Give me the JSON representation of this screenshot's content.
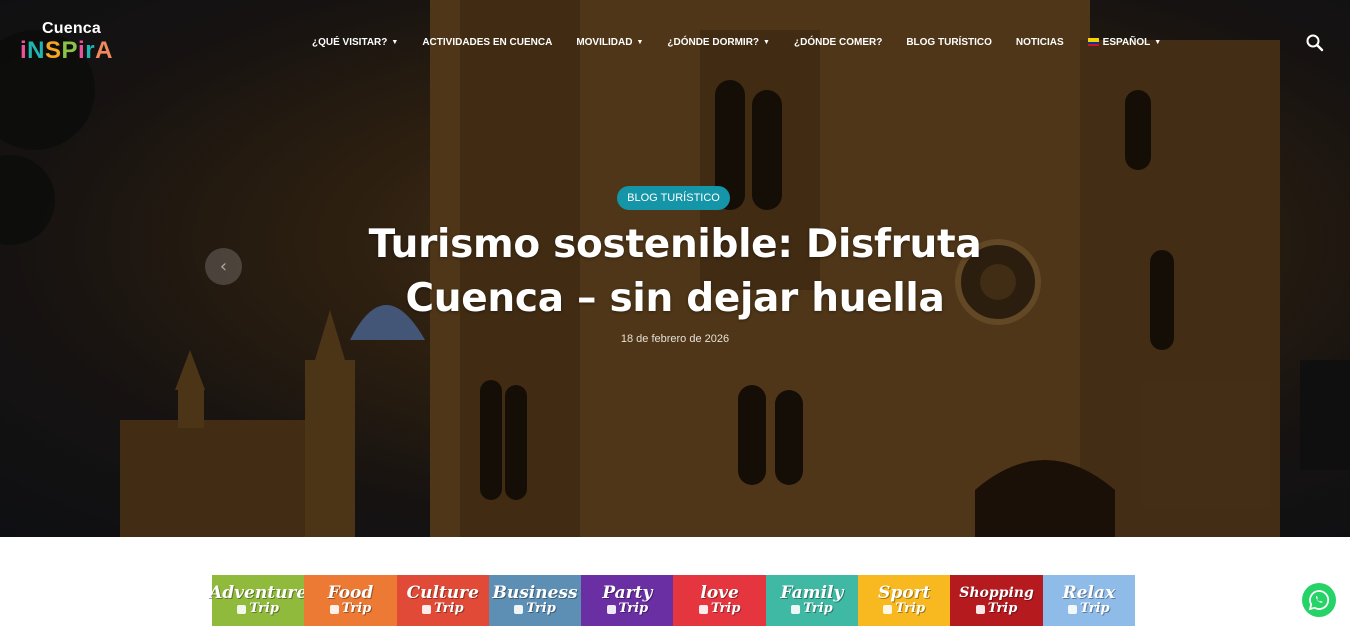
{
  "logo": {
    "line1": "Cuenca",
    "line2_letters": [
      "i",
      "N",
      "S",
      "P",
      "i",
      "r",
      "A"
    ],
    "line2_colors": [
      "#e9539b",
      "#20b5b0",
      "#f5a623",
      "#8bc34a",
      "#e9539b",
      "#20b5b0",
      "#f08a5d"
    ]
  },
  "nav": {
    "items": [
      {
        "label": "¿QUÉ VISITAR?",
        "dropdown": true
      },
      {
        "label": "ACTIVIDADES EN CUENCA",
        "dropdown": false
      },
      {
        "label": "MOVILIDAD",
        "dropdown": true
      },
      {
        "label": "¿DÓNDE DORMIR?",
        "dropdown": true
      },
      {
        "label": "¿DÓNDE COMER?",
        "dropdown": false
      },
      {
        "label": "BLOG TURÍSTICO",
        "dropdown": false
      },
      {
        "label": "NOTICIAS",
        "dropdown": false
      },
      {
        "label": "ESPAÑOL",
        "dropdown": true,
        "flag": "ecuador-flag-icon"
      }
    ],
    "search_icon": "search-icon"
  },
  "hero": {
    "category": "BLOG TURÍSTICO",
    "title": "Turismo sostenible: Disfruta Cuenca – sin dejar huella",
    "date": "18 de febrero de 2026",
    "prev_icon": "chevron-left-icon"
  },
  "trips": [
    {
      "word": "Adventure",
      "trip": "Trip",
      "color": "#8fba3c"
    },
    {
      "word": "Food",
      "trip": "Trip",
      "color": "#ec7a35"
    },
    {
      "word": "Culture",
      "trip": "Trip",
      "color": "#e04a36"
    },
    {
      "word": "Business",
      "trip": "Trip",
      "color": "#5d8fb5"
    },
    {
      "word": "Party",
      "trip": "Trip",
      "color": "#6a2fa3"
    },
    {
      "word": "love",
      "trip": "Trip",
      "color": "#e5363f"
    },
    {
      "word": "Family",
      "trip": "Trip",
      "color": "#3fb9a3"
    },
    {
      "word": "Sport",
      "trip": "Trip",
      "color": "#f8b820"
    },
    {
      "word": "Shopping",
      "trip": "Trip",
      "color": "#b51a1f"
    },
    {
      "word": "Relax",
      "trip": "Trip",
      "color": "#8fbbe9"
    }
  ],
  "colors": {
    "badge": "#1595a8",
    "whatsapp": "#25d366"
  },
  "whatsapp_icon": "whatsapp-icon"
}
